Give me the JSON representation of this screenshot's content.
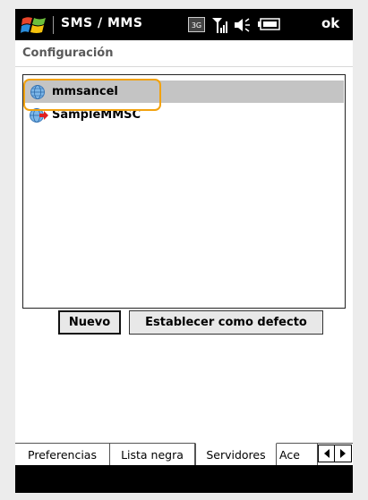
{
  "status_bar": {
    "app_title": "SMS / MMS",
    "ok_label": "ok"
  },
  "header": {
    "title": "Configuración"
  },
  "list": {
    "items": [
      {
        "label": "mmsancel",
        "selected": true,
        "icon": "globe-icon"
      },
      {
        "label": "SampleMMSC",
        "selected": false,
        "icon": "globe-arrow-icon"
      }
    ]
  },
  "buttons": {
    "new_label": "Nuevo",
    "set_default_label": "Establecer como defecto"
  },
  "tabs": {
    "items": [
      {
        "label": "Preferencias"
      },
      {
        "label": "Lista negra"
      },
      {
        "label": "Servidores",
        "active": true
      },
      {
        "label": "Ace"
      }
    ]
  },
  "colors": {
    "selection": "#c4c4c4",
    "focus_ring": "#f2a20f",
    "status_bar_bg": "#000000"
  }
}
